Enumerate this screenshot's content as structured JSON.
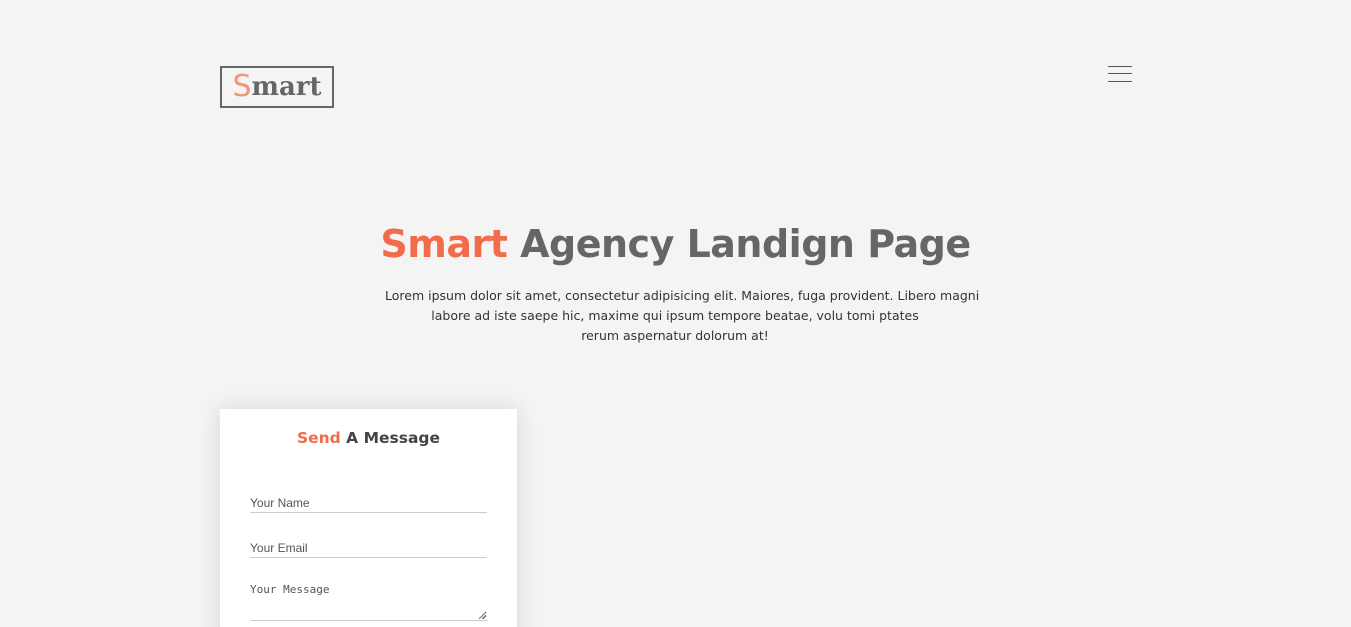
{
  "header": {
    "logo": {
      "accent": "S",
      "rest": "mart"
    },
    "menu_icon": "hamburger-menu-icon"
  },
  "hero": {
    "title_accent": "Smart",
    "title_rest": "Agency Landign Page",
    "text_lines": [
      "Lorem ipsum dolor sit amet, consectetur adipisicing elit. Maiores, fuga provident. Libero magni",
      "labore ad iste saepe hic, maxime qui ipsum tempore beatae, volu tomi ptates",
      "rerum aspernatur dolorum at!"
    ]
  },
  "contact_form": {
    "title_accent": "Send",
    "title_rest": "A Message",
    "name_placeholder": "Your Name",
    "email_placeholder": "Your Email",
    "message_placeholder": "Your Message"
  },
  "colors": {
    "accent": "#f26b4b",
    "logo_accent": "#f0977b",
    "text_gray": "#666666",
    "background": "#f4f4f4"
  }
}
